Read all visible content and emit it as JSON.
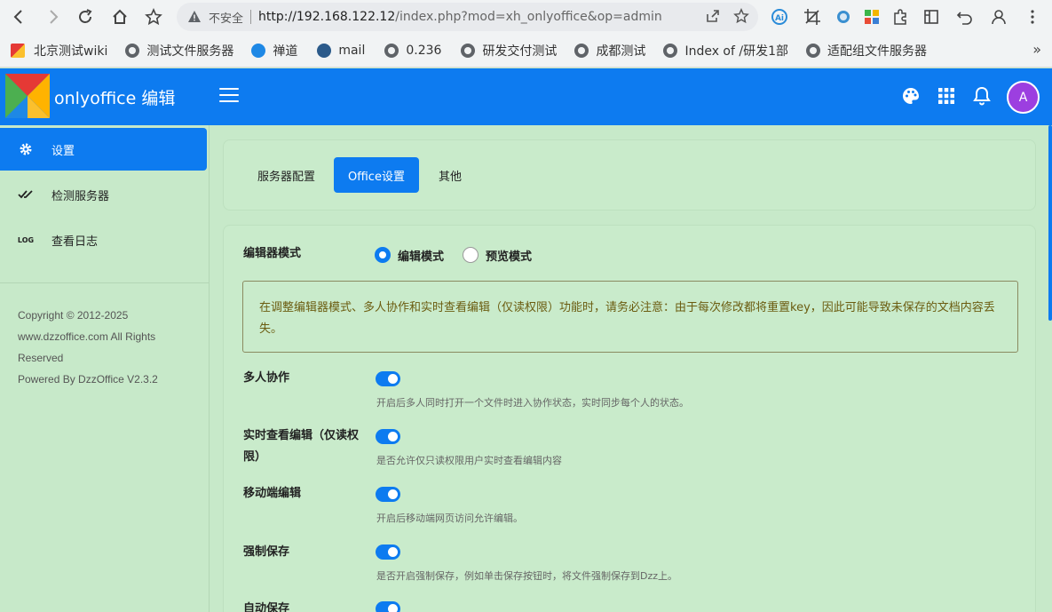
{
  "browser": {
    "insecure_label": "不安全",
    "url_host": "http://192.168.122.12",
    "url_rest": "/index.php?mod=xh_onlyoffice&op=admin",
    "bookmarks": [
      {
        "label": "北京测试wiki"
      },
      {
        "label": "测试文件服务器"
      },
      {
        "label": "禅道"
      },
      {
        "label": "mail"
      },
      {
        "label": "0.236"
      },
      {
        "label": "研发交付测试"
      },
      {
        "label": "成都测试"
      },
      {
        "label": "Index of /研发1部"
      },
      {
        "label": "适配组文件服务器"
      }
    ],
    "more_label": "»"
  },
  "header": {
    "title": "onlyoffice 编辑",
    "avatar_letter": "A"
  },
  "sidebar": {
    "items": [
      {
        "label": "设置"
      },
      {
        "label": "检测服务器"
      },
      {
        "label": "查看日志"
      }
    ],
    "copyright": "Copyright © 2012-2025 www.dzzoffice.com All Rights Reserved",
    "powered": "Powered By DzzOffice V2.3.2"
  },
  "tabs": [
    {
      "label": "服务器配置"
    },
    {
      "label": "Office设置"
    },
    {
      "label": "其他"
    }
  ],
  "form": {
    "editor_mode_label": "编辑器模式",
    "mode_edit": "编辑模式",
    "mode_preview": "预览模式",
    "alert": "在调整编辑器模式、多人协作和实时查看编辑（仅读权限）功能时，请务必注意：由于每次修改都将重置key，因此可能导致未保存的文档内容丢失。",
    "settings": [
      {
        "label": "多人协作",
        "help": "开启后多人同时打开一个文件时进入协作状态，实时同步每个人的状态。"
      },
      {
        "label": "实时查看编辑（仅读权限）",
        "help": "是否允许仅只读权限用户实时查看编辑内容"
      },
      {
        "label": "移动端编辑",
        "help": "开启后移动端网页访问允许编辑。"
      },
      {
        "label": "强制保存",
        "help": "是否开启强制保存，例如单击保存按钮时，将文件强制保存到Dzz上。"
      },
      {
        "label": "自动保存",
        "help": ""
      }
    ]
  },
  "colors": {
    "primary": "#0d7bf0",
    "background": "#c7e9c9",
    "avatar": "#9c3fe0"
  }
}
